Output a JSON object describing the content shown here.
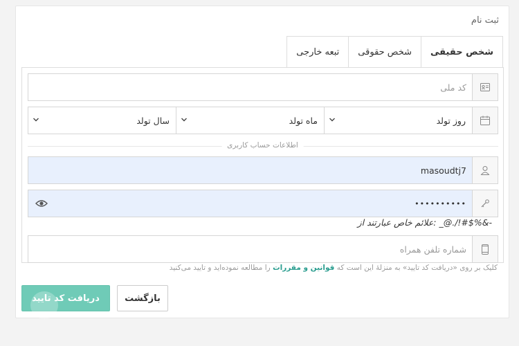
{
  "form": {
    "title": "ثبت نام",
    "tabs": [
      {
        "label": "شخص حقیقی",
        "active": true
      },
      {
        "label": "شخص حقوقی",
        "active": false
      },
      {
        "label": "تبعه خارجی",
        "active": false
      }
    ],
    "national_code": {
      "placeholder": "کد ملی",
      "value": "",
      "icon": "id-card-icon"
    },
    "birth": {
      "icon": "calendar-icon",
      "day": "روز تولد",
      "month": "ماه تولد",
      "year": "سال تولد"
    },
    "account_section_label": "اطلاعات حساب کاربری",
    "username": {
      "value": "masoudtj7",
      "icon": "user-icon"
    },
    "password": {
      "value": "••••••••••",
      "icon": "key-icon",
      "toggle_icon": "eye-icon"
    },
    "password_hint": "علائم خاص عبارتند از: _@./!#$%&-",
    "mobile": {
      "placeholder": "شماره تلفن همراه",
      "value": "",
      "icon": "mobile-icon"
    },
    "terms": {
      "before": "کلیک بر روی «دریافت کد تایید» به منزلهٔ این است که ",
      "link": "قوانین و مقررات",
      "after": " را مطالعه نموده‌اید و تایید می‌کنید"
    },
    "buttons": {
      "submit": "دریافت کد تایید",
      "back": "بازگشت"
    }
  },
  "colors": {
    "accent": "#6fcbb7",
    "link": "#2a9d8f",
    "autofill": "#e8f0fd"
  }
}
